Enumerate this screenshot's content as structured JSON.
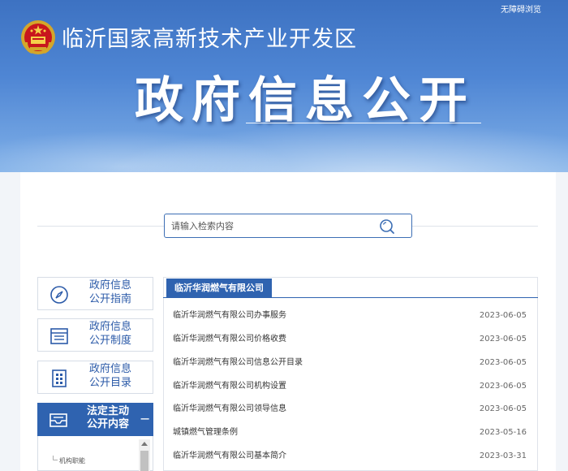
{
  "header": {
    "accessibility_link": "无障碍浏览",
    "site_name": "临沂国家高新技术产业开发区",
    "banner_title": "政府信息公开"
  },
  "search": {
    "placeholder": "请输入检索内容"
  },
  "sidebar": {
    "items": [
      {
        "line1": "政府信息",
        "line2": "公开指南",
        "icon": "compass-icon"
      },
      {
        "line1": "政府信息",
        "line2": "公开制度",
        "icon": "document-list-icon"
      },
      {
        "line1": "政府信息",
        "line2": "公开目录",
        "icon": "grid-list-icon"
      }
    ],
    "active": {
      "line1": "法定主动",
      "line2": "公开内容",
      "icon": "inbox-icon",
      "toggle": "−"
    },
    "sub_items": [
      "机构职能"
    ]
  },
  "list": {
    "tab_label": "临沂华润燃气有限公司",
    "rows": [
      {
        "title": "临沂华润燃气有限公司办事服务",
        "date": "2023-06-05"
      },
      {
        "title": "临沂华润燃气有限公司价格收费",
        "date": "2023-06-05"
      },
      {
        "title": "临沂华润燃气有限公司信息公开目录",
        "date": "2023-06-05"
      },
      {
        "title": "临沂华润燃气有限公司机构设置",
        "date": "2023-06-05"
      },
      {
        "title": "临沂华润燃气有限公司领导信息",
        "date": "2023-06-05"
      },
      {
        "title": "城镇燃气管理条例",
        "date": "2023-05-16"
      },
      {
        "title": "临沂华润燃气有限公司基本简介",
        "date": "2023-03-31"
      }
    ]
  },
  "colors": {
    "brand_blue": "#2f63b0",
    "banner_blue": "#4f86d4"
  }
}
